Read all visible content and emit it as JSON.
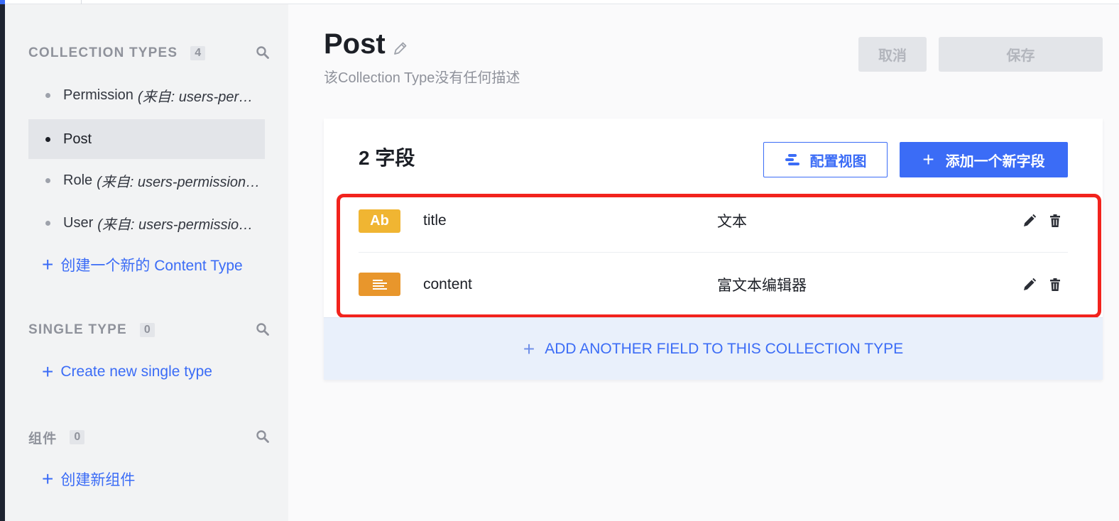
{
  "colors": {
    "accent": "#3b6cf6",
    "text_badge": "#f0b532",
    "richtext_badge": "#e8962c",
    "highlight": "#f2231d"
  },
  "sidebar": {
    "collection_types": {
      "title": "COLLECTION TYPES",
      "count": "4",
      "items": [
        {
          "label": "Permission",
          "source": "(来自: users-per…",
          "active": false
        },
        {
          "label": "Post",
          "source": "",
          "active": true
        },
        {
          "label": "Role",
          "source": "(来自: users-permission…",
          "active": false
        },
        {
          "label": "User",
          "source": "(来自: users-permissio…",
          "active": false
        }
      ],
      "create_label": "创建一个新的 Content Type"
    },
    "single_types": {
      "title": "SINGLE TYPE",
      "count": "0",
      "create_label": "Create new single type"
    },
    "components": {
      "title": "组件",
      "count": "0",
      "create_label": "创建新组件"
    }
  },
  "header": {
    "title": "Post",
    "description": "该Collection Type没有任何描述",
    "cancel_label": "取消",
    "save_label": "保存"
  },
  "fields_card": {
    "count_label": "2 字段",
    "configure_view_label": "配置视图",
    "add_field_label": "添加一个新字段",
    "fields": [
      {
        "badge": "Ab",
        "badge_icon": "text-icon",
        "name": "title",
        "type": "文本"
      },
      {
        "badge": "",
        "badge_icon": "richtext-icon",
        "name": "content",
        "type": "富文本编辑器"
      }
    ],
    "add_another_label": "ADD ANOTHER FIELD TO THIS COLLECTION TYPE"
  }
}
